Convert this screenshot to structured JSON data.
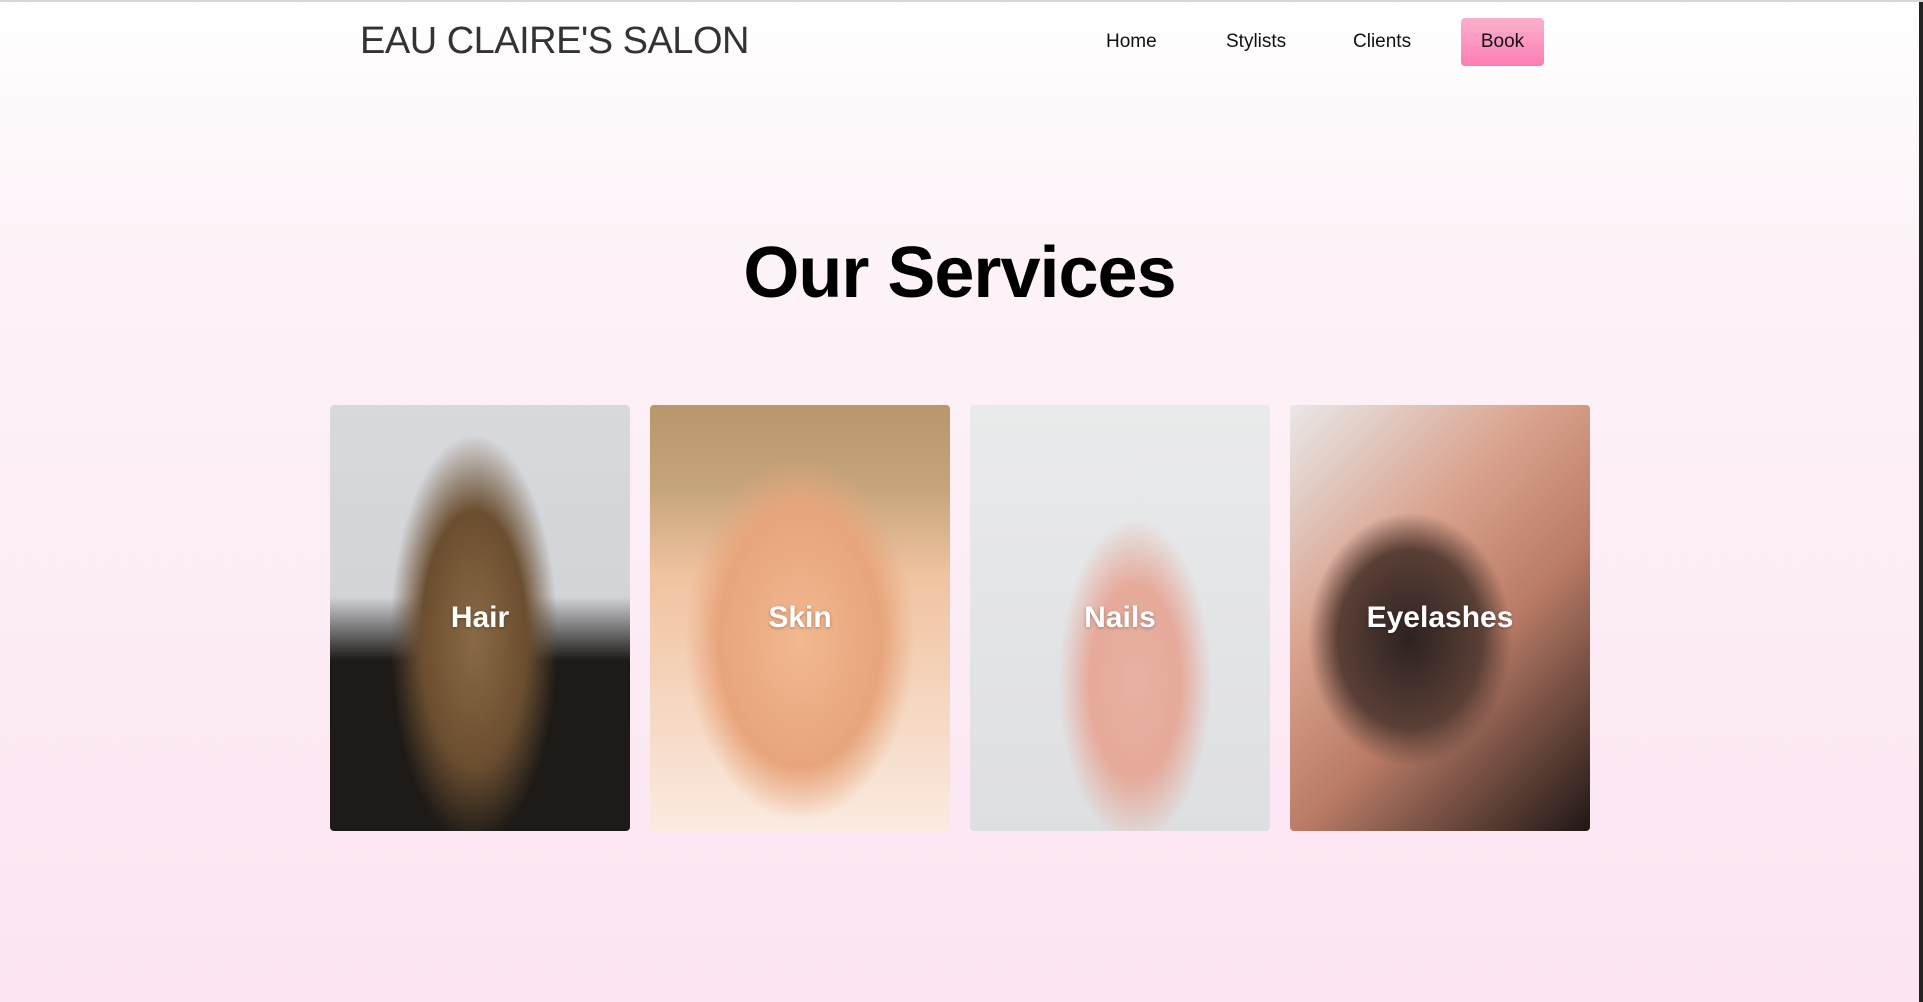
{
  "header": {
    "logo": "EAU CLAIRE'S SALON",
    "nav": [
      "Home",
      "Stylists",
      "Clients"
    ],
    "book_label": "Book"
  },
  "main": {
    "title": "Our Services",
    "services": [
      {
        "label": "Hair"
      },
      {
        "label": "Skin"
      },
      {
        "label": "Nails"
      },
      {
        "label": "Eyelashes"
      }
    ]
  },
  "colors": {
    "accent": "#fb8fbd",
    "background_bottom": "#fce4f2"
  }
}
